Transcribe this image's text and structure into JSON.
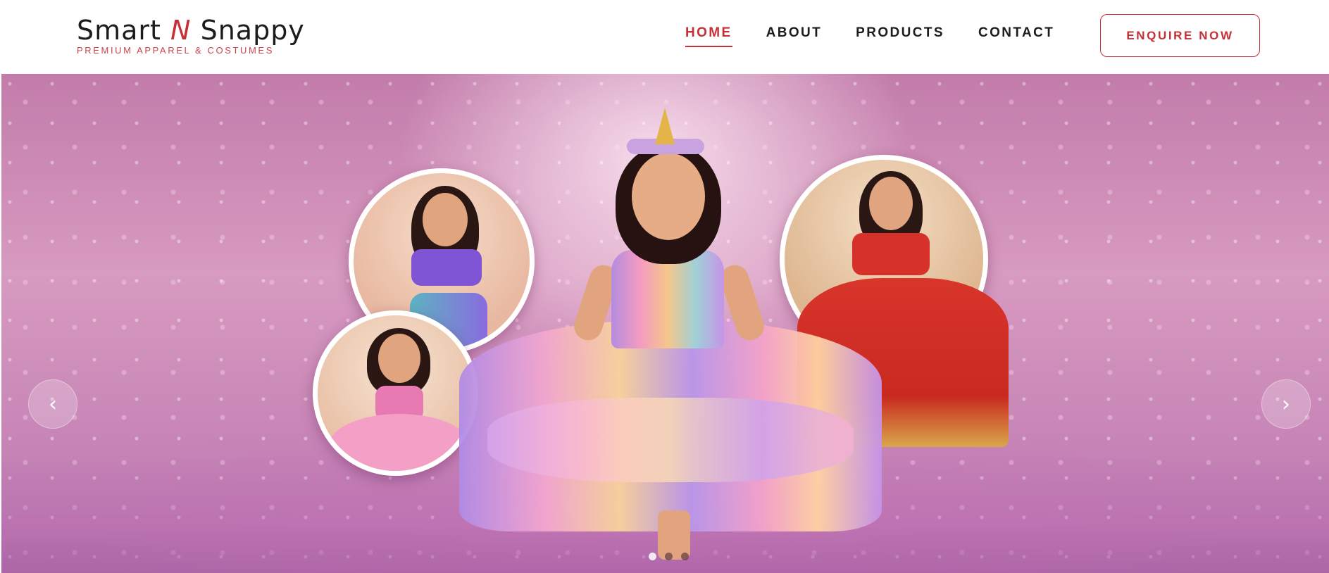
{
  "brand": {
    "name_part1": "Smart",
    "name_n": "N",
    "name_part2": "Snappy",
    "tagline": "PREMIUM APPAREL & COSTUMES"
  },
  "nav": {
    "items": [
      {
        "label": "HOME",
        "active": true
      },
      {
        "label": "ABOUT",
        "active": false
      },
      {
        "label": "PRODUCTS",
        "active": false
      },
      {
        "label": "CONTACT",
        "active": false
      }
    ],
    "cta_label": "ENQUIRE NOW"
  },
  "hero": {
    "prev_icon": "chevron-left-icon",
    "next_icon": "chevron-right-icon",
    "prev_glyph": "‹",
    "next_glyph": "›",
    "slide_count": 3,
    "active_slide": 1
  },
  "colors": {
    "accent": "#c62f35",
    "text": "#1c1c1c",
    "hero_pink": "#d79ac0"
  }
}
